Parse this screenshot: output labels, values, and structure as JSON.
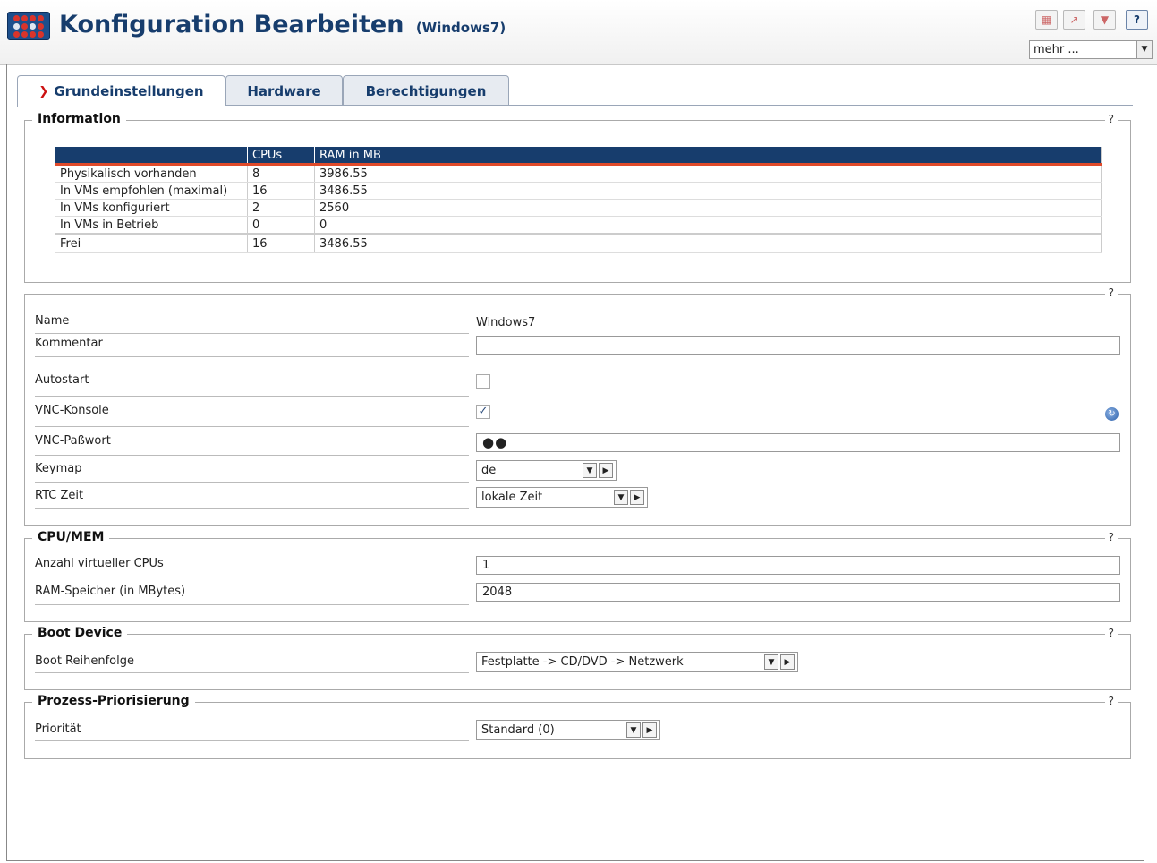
{
  "header": {
    "title": "Konfiguration Bearbeiten",
    "subtitle": "(Windows7)",
    "toolbar_icons": [
      "table-export-icon",
      "edit-icon",
      "save-icon",
      "help-icon"
    ],
    "help_label": "?",
    "more_select": "mehr ..."
  },
  "tabs": [
    {
      "label": "Grundeinstellungen",
      "active": true
    },
    {
      "label": "Hardware",
      "active": false
    },
    {
      "label": "Berechtigungen",
      "active": false
    }
  ],
  "information": {
    "legend": "Information",
    "help": "?",
    "columns": [
      "",
      "CPUs",
      "RAM in MB"
    ],
    "rows": [
      [
        "Physikalisch vorhanden",
        "8",
        "3986.55"
      ],
      [
        "In VMs empfohlen (maximal)",
        "16",
        "3486.55"
      ],
      [
        "In VMs konfiguriert",
        "2",
        "2560"
      ],
      [
        "In VMs in Betrieb",
        "0",
        "0"
      ]
    ],
    "total": [
      "Frei",
      "16",
      "3486.55"
    ]
  },
  "general": {
    "help": "?",
    "name_label": "Name",
    "name_value": "Windows7",
    "comment_label": "Kommentar",
    "comment_value": "",
    "autostart_label": "Autostart",
    "autostart_checked": false,
    "vnc_console_label": "VNC-Konsole",
    "vnc_console_checked": true,
    "vnc_password_label": "VNC-Paßwort",
    "vnc_password_value": "●●",
    "keymap_label": "Keymap",
    "keymap_value": "de",
    "rtc_label": "RTC Zeit",
    "rtc_value": "lokale Zeit"
  },
  "cpumem": {
    "legend": "CPU/MEM",
    "help": "?",
    "cpus_label": "Anzahl virtueller CPUs",
    "cpus_value": "1",
    "ram_label": "RAM-Speicher (in MBytes)",
    "ram_value": "2048"
  },
  "boot": {
    "legend": "Boot Device",
    "help": "?",
    "order_label": "Boot Reihenfolge",
    "order_value": "Festplatte -> CD/DVD -> Netzwerk"
  },
  "priority": {
    "legend": "Prozess-Priorisierung",
    "help": "?",
    "label": "Priorität",
    "value": "Standard (0)"
  },
  "colors": {
    "brand_blue": "#173d6d",
    "accent_red": "#e04a2a"
  }
}
